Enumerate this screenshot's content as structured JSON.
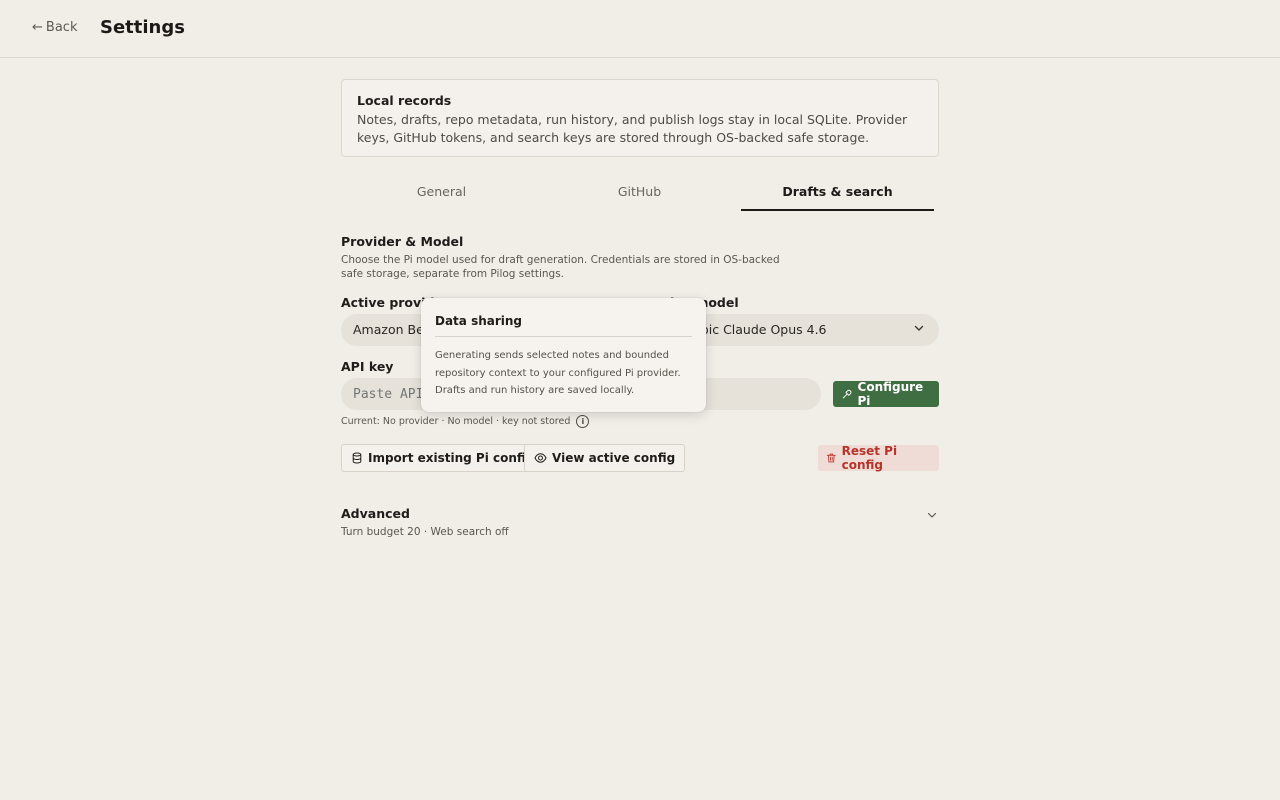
{
  "header": {
    "back_arrow": "←",
    "back_label": "Back",
    "title": "Settings"
  },
  "notice": {
    "title": "Local records",
    "body": "Notes, drafts, repo metadata, run history, and publish logs stay in local SQLite. Provider keys, GitHub tokens, and search keys are stored through OS-backed safe storage."
  },
  "tabs": [
    {
      "label": "General",
      "active": false
    },
    {
      "label": "GitHub",
      "active": false
    },
    {
      "label": "Drafts & search",
      "active": true
    }
  ],
  "provider_section": {
    "title": "Provider & Model",
    "description": "Choose the Pi model used for draft generation. Credentials are stored in OS-backed safe storage, separate from Pilog settings.",
    "active_provider_label": "Active provider",
    "active_provider_value": "Amazon Bedrock",
    "active_model_label": "Active model",
    "active_model_value": "Anthropic Claude Opus 4.6",
    "api_key_label": "API key",
    "api_key_placeholder": "Paste API key",
    "configure_button": "Configure Pi",
    "status": "Current: No provider · No model · key not stored",
    "import_button": "Import existing Pi config",
    "view_button": "View active config",
    "reset_button": "Reset Pi config"
  },
  "advanced": {
    "title": "Advanced",
    "subtitle": "Turn budget 20 · Web search off"
  },
  "tooltip": {
    "title": "Data sharing",
    "body": "Generating sends selected notes and bounded repository context to your configured Pi provider. Drafts and run history are saved locally."
  },
  "colors": {
    "background": "#f1eee8",
    "primary_green": "#3f6e43",
    "danger_red": "#b8342b",
    "danger_bg": "#f0dcd7"
  },
  "icons": {
    "back": "arrow-left-icon",
    "chevron": "chevron-down-icon",
    "configure": "plug-icon",
    "info": "info-icon",
    "import": "database-icon",
    "view": "eye-icon",
    "reset": "trash-icon"
  }
}
